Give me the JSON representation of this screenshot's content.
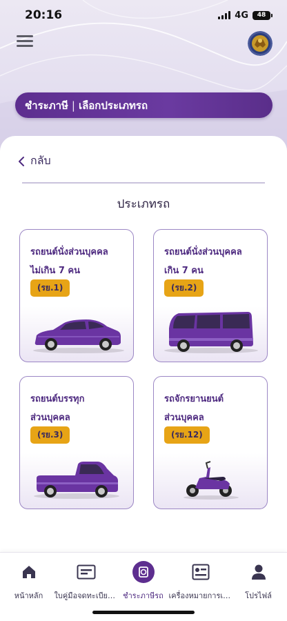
{
  "status_bar": {
    "time": "20:16",
    "network": "4G",
    "battery": "48"
  },
  "header": {
    "menu_icon": "hamburger-menu-icon",
    "emblem_icon": "garuda-emblem-icon",
    "title_part1": "ชำระภาษี",
    "separator": "|",
    "title_part2": "เลือกประเภทรถ"
  },
  "main": {
    "back_label": "กลับ",
    "section_title": "ประเภทรถ",
    "cards": [
      {
        "line1": "รถยนต์นั่งส่วนบุคคล",
        "line2": "ไม่เกิน 7 คน",
        "badge": "(รย.1)",
        "icon": "sedan-car-icon"
      },
      {
        "line1": "รถยนต์นั่งส่วนบุคคล",
        "line2": "เกิน 7 คน",
        "badge": "(รย.2)",
        "icon": "van-icon"
      },
      {
        "line1": "รถยนต์บรรทุก",
        "line2": "ส่วนบุคคล",
        "badge": "(รย.3)",
        "icon": "pickup-truck-icon"
      },
      {
        "line1": "รถจักรยานยนต์",
        "line2": "ส่วนบุคคล",
        "badge": "(รย.12)",
        "icon": "motorcycle-icon"
      }
    ]
  },
  "tabbar": {
    "items": [
      {
        "label": "หน้าหลัก",
        "icon": "home-icon",
        "active": false
      },
      {
        "label": "ใบคู่มือจดทะเบียนรถ",
        "icon": "registration-book-icon",
        "active": false
      },
      {
        "label": "ชำระภาษีรถ",
        "icon": "tax-payment-icon",
        "active": true
      },
      {
        "label": "เครื่องหมายการเสียภาษี",
        "icon": "tax-sticker-icon",
        "active": false
      },
      {
        "label": "โปรไฟล์",
        "icon": "profile-icon",
        "active": false
      }
    ]
  },
  "colors": {
    "primary": "#5d2e8f",
    "accent_badge": "#e7a416",
    "card_border": "#9b86c4"
  }
}
